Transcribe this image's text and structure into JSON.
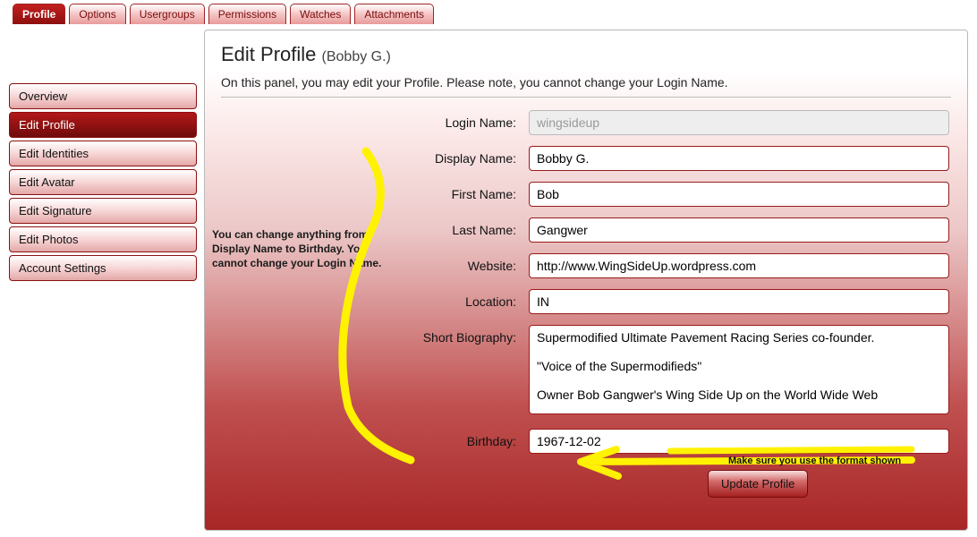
{
  "top_tabs": {
    "active": "Profile",
    "items": [
      "Profile",
      "Options",
      "Usergroups",
      "Permissions",
      "Watches",
      "Attachments"
    ]
  },
  "sidebar": {
    "active": "Edit Profile",
    "items": [
      "Overview",
      "Edit Profile",
      "Edit Identities",
      "Edit Avatar",
      "Edit Signature",
      "Edit Photos",
      "Account Settings"
    ]
  },
  "panel": {
    "title": "Edit Profile",
    "title_sub": "(Bobby G.)",
    "instructions": "On this panel, you may edit your Profile. Please note, you cannot change your Login Name."
  },
  "annotations": {
    "left_note": "You can change anything from Display Name to Birthday. You cannot change your Login Name.",
    "birthday_note": "Make sure you use the format shown"
  },
  "form": {
    "login_name": {
      "label": "Login Name:",
      "value": "wingsideup"
    },
    "display_name": {
      "label": "Display Name:",
      "value": "Bobby G."
    },
    "first_name": {
      "label": "First Name:",
      "value": "Bob"
    },
    "last_name": {
      "label": "Last Name:",
      "value": "Gangwer"
    },
    "website": {
      "label": "Website:",
      "value": "http://www.WingSideUp.wordpress.com"
    },
    "location": {
      "label": "Location:",
      "value": "IN"
    },
    "bio": {
      "label": "Short Biography:",
      "value": "Supermodified Ultimate Pavement Racing Series co-founder.\n\n\"Voice of the Supermodifieds\"\n\nOwner Bob Gangwer's Wing Side Up on the World Wide Web"
    },
    "birthday": {
      "label": "Birthday:",
      "value": "1967-12-02"
    },
    "submit_label": "Update Profile"
  }
}
